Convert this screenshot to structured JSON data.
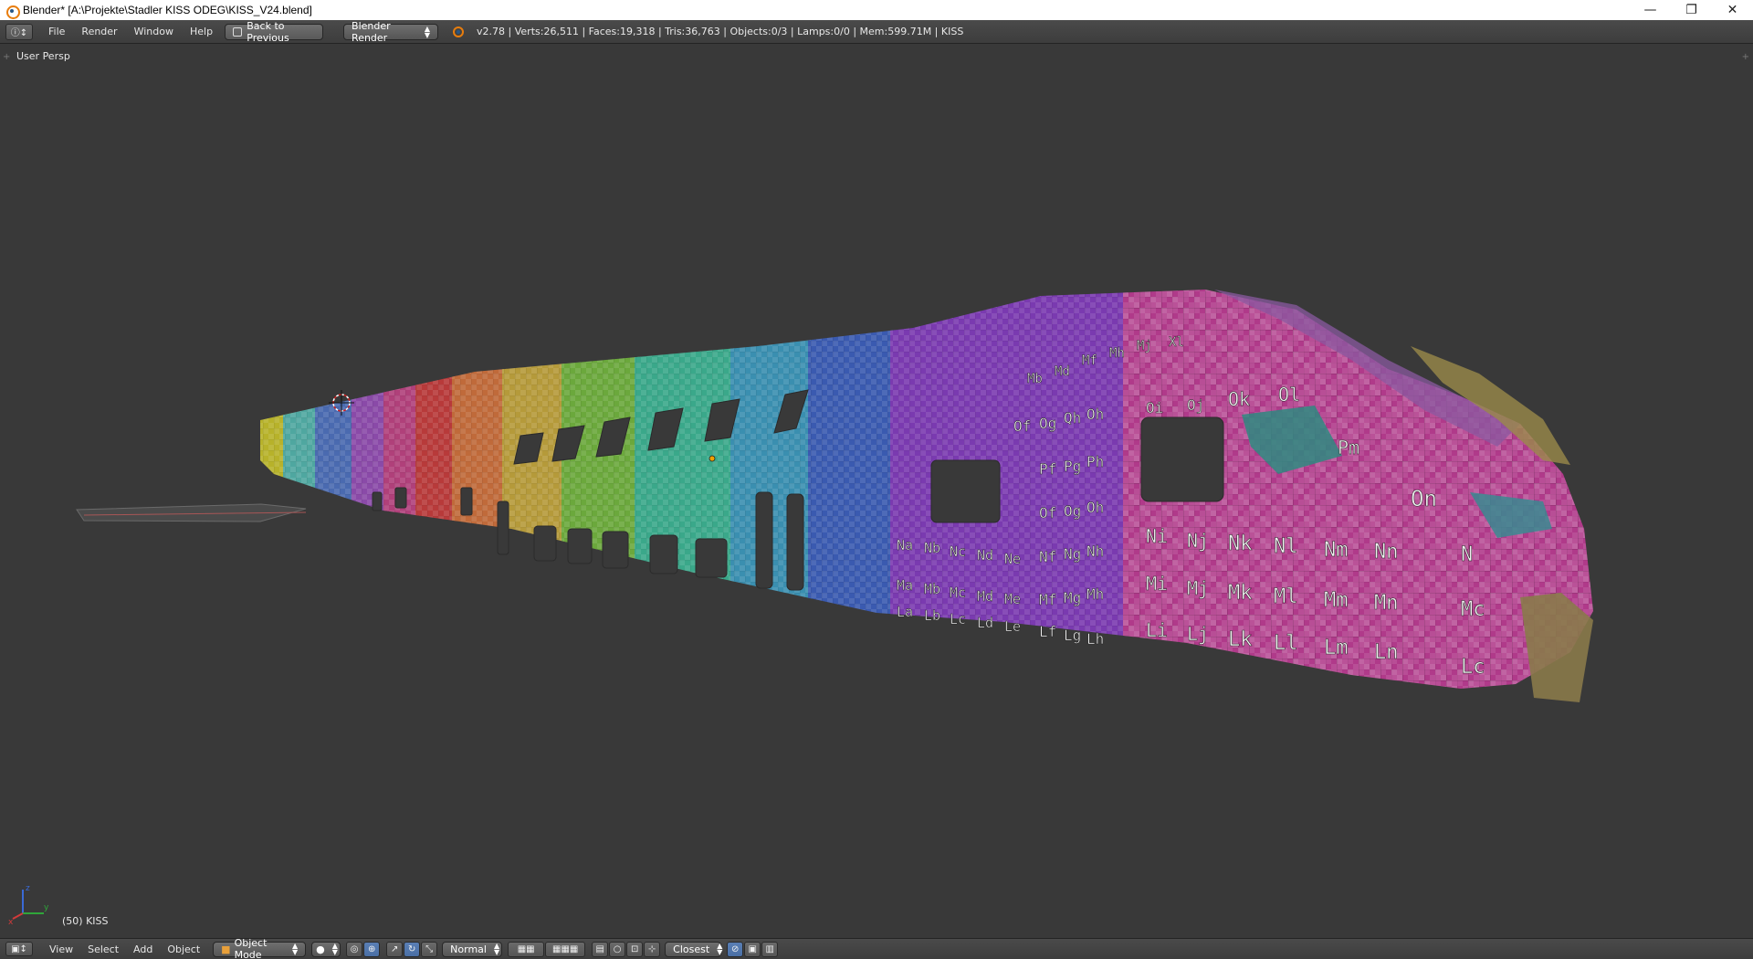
{
  "window": {
    "title": "Blender* [A:\\Projekte\\Stadler KISS ODEG\\KISS_V24.blend]",
    "minimize": "—",
    "maximize": "❐",
    "close": "✕"
  },
  "info_header": {
    "menus": [
      "File",
      "Render",
      "Window",
      "Help"
    ],
    "back_button": "Back to Previous",
    "render_engine": "Blender Render",
    "stats": "v2.78 | Verts:26,511 | Faces:19,318 | Tris:36,763 | Objects:0/3 | Lamps:0/0 | Mem:599.71M | KISS"
  },
  "viewport": {
    "view_name": "User Persp",
    "object_info": "(50) KISS"
  },
  "view_header": {
    "menus": [
      "View",
      "Select",
      "Add",
      "Object"
    ],
    "mode": "Object Mode",
    "pivot_orientation": "Normal",
    "snap_target": "Closest"
  },
  "colors": {
    "viewport_bg": "#393939",
    "header_bg": "#444444",
    "accent_orange": "#e87d0d",
    "active_blue": "#5680c2"
  }
}
